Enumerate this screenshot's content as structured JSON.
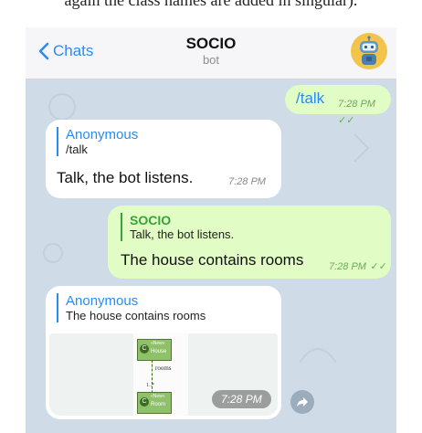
{
  "caption": "again the class names are added in singular).",
  "header": {
    "back_label": "Chats",
    "title": "SOCIO",
    "subtitle": "bot"
  },
  "messages": [
    {
      "text": "/talk",
      "time": "7:28 PM"
    },
    {
      "reply_name": "Anonymous",
      "reply_text": "/talk",
      "text": "Talk, the bot listens.",
      "time": "7:28 PM"
    },
    {
      "reply_name": "SOCIO",
      "reply_text": "Talk, the bot listens.",
      "text": "The house contains rooms",
      "time": "7:28 PM"
    },
    {
      "reply_name": "Anonymous",
      "reply_text": "The house contains rooms",
      "time": "7:28 PM",
      "diagram": {
        "class1_stereotype": "«New»",
        "class1_name": "House",
        "assoc_label": "rooms",
        "multiplicity": "1..*",
        "class2_stereotype": "«New»",
        "class2_name": "Room"
      }
    }
  ],
  "colors": {
    "accent": "#2a8bf2",
    "outgoing_bubble": "#e1fcc4",
    "chat_bg": "#cfdbe6"
  }
}
